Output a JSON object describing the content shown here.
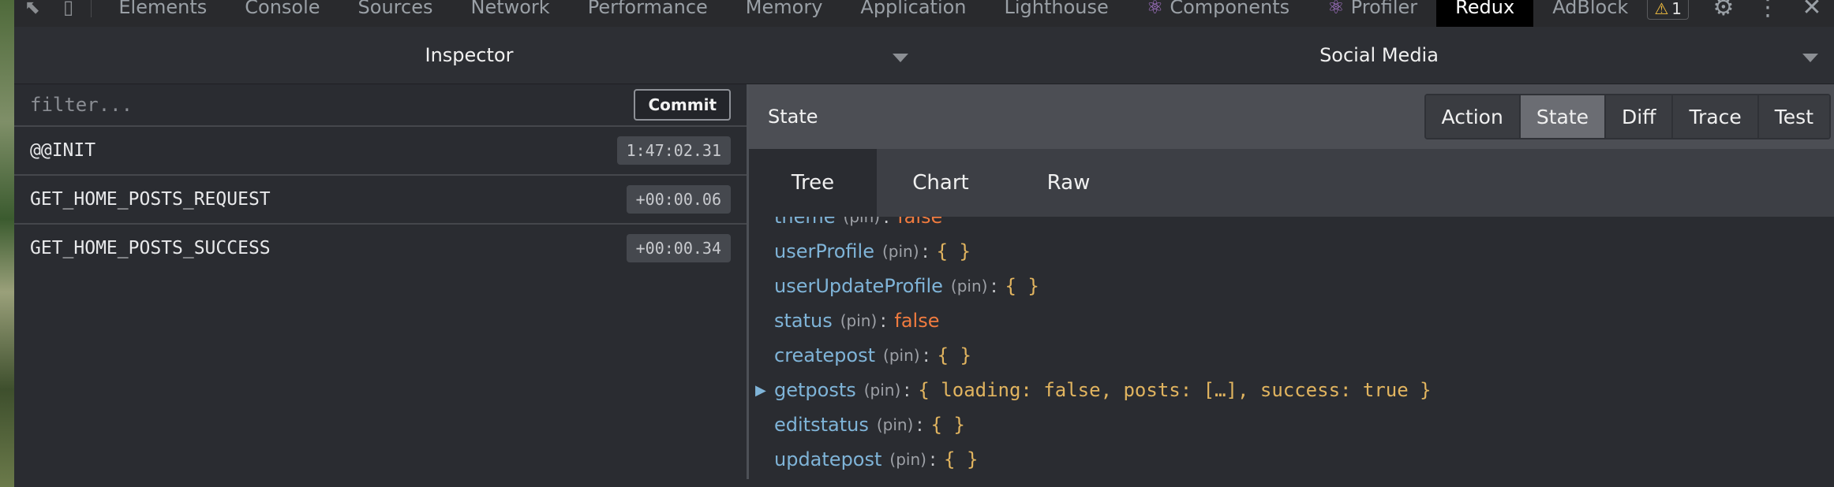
{
  "devtools": {
    "tabs": [
      {
        "label": "Elements"
      },
      {
        "label": "Console"
      },
      {
        "label": "Sources"
      },
      {
        "label": "Network"
      },
      {
        "label": "Performance"
      },
      {
        "label": "Memory"
      },
      {
        "label": "Application"
      },
      {
        "label": "Lighthouse"
      },
      {
        "label": "Components",
        "icon": "react-icon"
      },
      {
        "label": "Profiler",
        "icon": "react-icon"
      },
      {
        "label": "Redux",
        "active": true
      },
      {
        "label": "AdBlock"
      }
    ],
    "warning_count": "1",
    "icons": [
      "inspect-element-icon",
      "device-toggle-icon",
      "warning-icon",
      "settings-gear-icon",
      "more-vertical-icon",
      "close-icon"
    ]
  },
  "redux": {
    "monitor_select": "Inspector",
    "store_select": "Social Media",
    "filter_placeholder": "filter...",
    "commit_label": "Commit",
    "actions": [
      {
        "name": "@@INIT",
        "time": "1:47:02.31"
      },
      {
        "name": "GET_HOME_POSTS_REQUEST",
        "time": "+00:00.06"
      },
      {
        "name": "GET_HOME_POSTS_SUCCESS",
        "time": "+00:00.34"
      }
    ],
    "panel_title": "State",
    "modes": [
      "Action",
      "State",
      "Diff",
      "Trace",
      "Test"
    ],
    "active_mode": "State",
    "view_tabs": [
      "Tree",
      "Chart",
      "Raw"
    ],
    "active_view": "Tree",
    "pin_label": "(pin)",
    "tree": [
      {
        "key": "theme",
        "value": "false"
      },
      {
        "key": "userProfile",
        "value": "{ }"
      },
      {
        "key": "userUpdateProfile",
        "value": "{ }"
      },
      {
        "key": "status",
        "value": "false"
      },
      {
        "key": "createpost",
        "value": "{ }"
      },
      {
        "key": "getposts",
        "value": "{ loading: false, posts: […], success: true }",
        "collapsed": true
      },
      {
        "key": "editstatus",
        "value": "{ }"
      },
      {
        "key": "updatepost",
        "value": "{ }"
      }
    ]
  },
  "colors": {
    "key": "#7fb4d8",
    "object_value": "#e1b45f",
    "boolean_value": "#f07b3f",
    "panel_bg": "#2a2c31",
    "active_tab": "#000000"
  }
}
